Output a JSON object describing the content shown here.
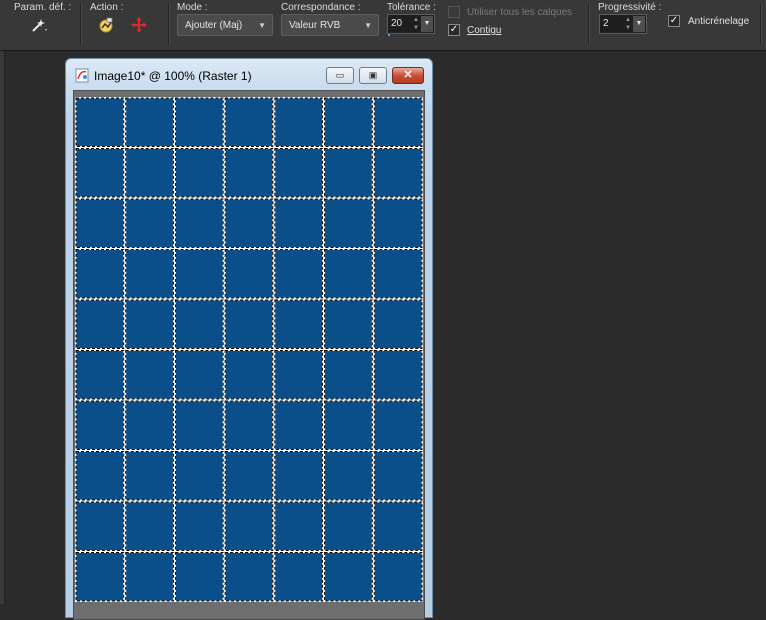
{
  "toolbar": {
    "presets_label": "Param. déf. :",
    "action_label": "Action :",
    "mode_label": "Mode :",
    "mode_value": "Ajouter (Maj)",
    "match_label": "Correspondance :",
    "match_value": "Valeur RVB",
    "tolerance_label": "Tolérance :",
    "tolerance_value": "20",
    "use_all_layers_label": "Utiliser tous les calques",
    "use_all_layers_checked": false,
    "contiguous_label": "Contigu",
    "contiguous_checked": true,
    "feather_label": "Progressivité :",
    "feather_value": "2",
    "antialias_label": "Anticrénelage",
    "antialias_checked": true
  },
  "icons": {
    "presets": "magic-wand-icon",
    "action_apply": "apply-icon",
    "action_reset": "reset-icon"
  },
  "window": {
    "title": "Image10* @ 100% (Raster 1)",
    "minimize_symbol": "▭",
    "maximize_symbol": "▣",
    "close_symbol": "✕"
  },
  "canvas": {
    "fill_color": "#0b4f8a",
    "line_color": "#ffffff",
    "columns": 7,
    "rows": 10
  },
  "colors": {
    "accent": "#4aa3ff",
    "toolbar_bg": "#383838",
    "workspace_bg": "#2b2b2b",
    "close_button": "#c9503a"
  }
}
